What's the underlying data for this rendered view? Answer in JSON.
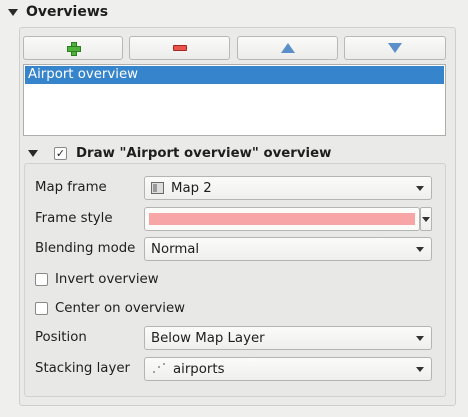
{
  "section": {
    "title": "Overviews"
  },
  "toolbar": {
    "add_icon": "plus-icon",
    "remove_icon": "minus-icon",
    "up_icon": "arrow-up-icon",
    "down_icon": "arrow-down-icon"
  },
  "overview_list": {
    "items": [
      {
        "label": "Airport overview",
        "selected": true
      }
    ]
  },
  "draw_overview": {
    "checked": true,
    "check_mark": "✓",
    "label": "Draw \"Airport overview\" overview"
  },
  "fields": {
    "map_frame": {
      "label": "Map frame",
      "value": "Map 2"
    },
    "frame_style": {
      "label": "Frame style",
      "color": "#f7a5a7"
    },
    "blending_mode": {
      "label": "Blending mode",
      "value": "Normal"
    },
    "invert_overview": {
      "label": "Invert overview",
      "checked": false
    },
    "center_on_overview": {
      "label": "Center on overview",
      "checked": false
    },
    "position": {
      "label": "Position",
      "value": "Below Map Layer"
    },
    "stacking_layer": {
      "label": "Stacking layer",
      "value": "airports"
    }
  },
  "colors": {
    "selection": "#3584cc",
    "add": "#4db33a",
    "remove": "#e8534e",
    "arrows": "#5a8fc9"
  }
}
